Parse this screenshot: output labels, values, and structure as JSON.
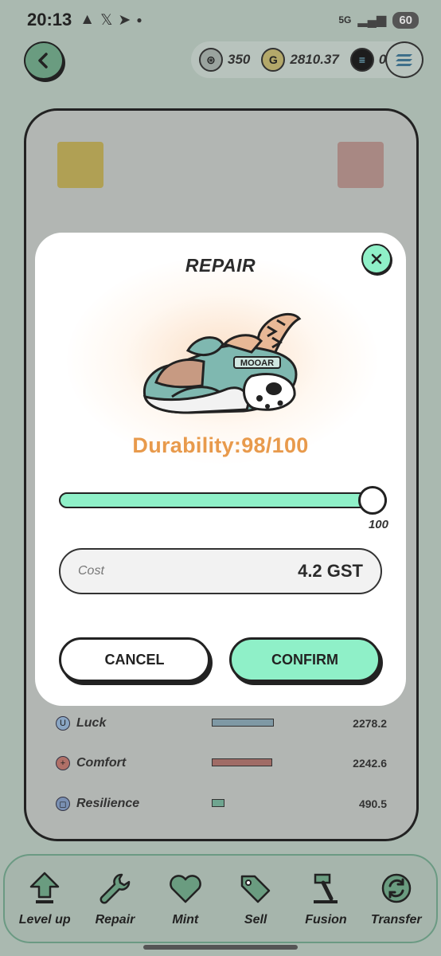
{
  "status_bar": {
    "time": "20:13",
    "icons": [
      "warning-icon",
      "x-icon",
      "telegram-icon",
      "dot-icon"
    ],
    "network": "5G",
    "battery": "60"
  },
  "wallet": {
    "energy": "350",
    "gst": "2810.37",
    "sol": "0",
    "coin_glyphs": {
      "energy": "⊛",
      "gst": "G",
      "sol": "≡"
    }
  },
  "attributes": [
    {
      "icon": "U",
      "name": "Luck",
      "value": "2278.2",
      "fill": 0.95,
      "color": "#7f99a5"
    },
    {
      "icon": "+",
      "name": "Comfort",
      "value": "2242.6",
      "fill": 0.93,
      "color": "#a06c66"
    },
    {
      "icon": "◻",
      "name": "Resilience",
      "value": "490.5",
      "fill": 0.2,
      "color": "#6fa590"
    }
  ],
  "modal": {
    "title": "REPAIR",
    "durability": "Durability:98/100",
    "shoe_brand": "MOOAR",
    "slider_value": 100,
    "slider_max_label": "100",
    "cost_label": "Cost",
    "cost_value": "4.2 GST",
    "cancel_label": "CANCEL",
    "confirm_label": "CONFIRM"
  },
  "nav": [
    {
      "label": "Level up",
      "icon": "level-up-icon"
    },
    {
      "label": "Repair",
      "icon": "wrench-icon"
    },
    {
      "label": "Mint",
      "icon": "heart-icon"
    },
    {
      "label": "Sell",
      "icon": "tag-icon"
    },
    {
      "label": "Fusion",
      "icon": "hammer-icon"
    },
    {
      "label": "Transfer",
      "icon": "transfer-icon"
    }
  ],
  "colors": {
    "accent": "#8ff0c8",
    "durability": "#e89a4c",
    "overlay_bg": "#aab9b0"
  }
}
